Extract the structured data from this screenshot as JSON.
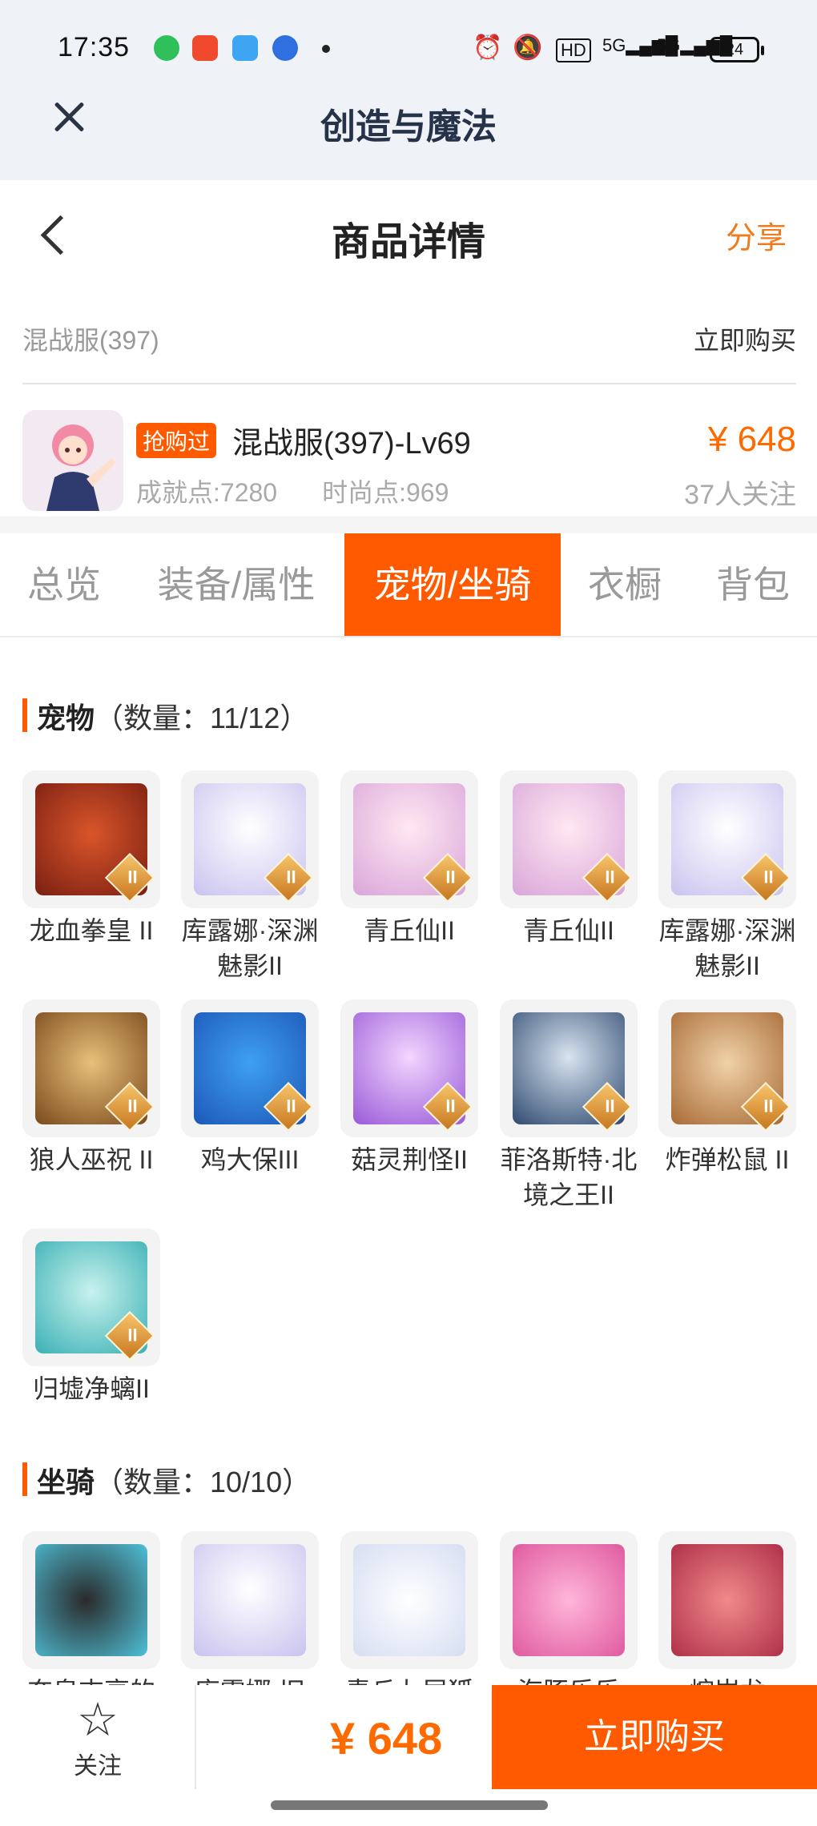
{
  "status": {
    "time": "17:35",
    "network": "5G",
    "battery": "24"
  },
  "app": {
    "title": "创造与魔法"
  },
  "header": {
    "title": "商品详情",
    "share": "分享"
  },
  "server": {
    "name": "混战服(397)",
    "buy_now": "立即购买"
  },
  "product": {
    "badge": "抢购过",
    "name": "混战服(397)-Lv69",
    "achievement": "成就点:7280",
    "fashion": "时尚点:969",
    "price": "¥ 648",
    "followers": "37人关注"
  },
  "tabs": [
    {
      "label": "总览"
    },
    {
      "label": "装备/属性"
    },
    {
      "label": "宠物/坐骑"
    },
    {
      "label": "衣橱"
    },
    {
      "label": "背包"
    }
  ],
  "pets": {
    "title": "宠物",
    "count": "（数量：11/12）",
    "items": [
      {
        "name": "龙血拳皇 II"
      },
      {
        "name": "库露娜·深渊魅影II"
      },
      {
        "name": "青丘仙II"
      },
      {
        "name": "青丘仙II"
      },
      {
        "name": "库露娜·深渊魅影II"
      },
      {
        "name": "狼人巫祝 II"
      },
      {
        "name": "鸡大保III"
      },
      {
        "name": "菇灵荆怪II"
      },
      {
        "name": "菲洛斯特·北境之王II"
      },
      {
        "name": "炸弹松鼠 II"
      },
      {
        "name": "归墟净螭II"
      }
    ]
  },
  "mounts": {
    "title": "坐骑",
    "count": "（数量：10/10）",
    "items": [
      {
        "name": "奔泉吉享的"
      },
      {
        "name": "库露娜·旧"
      },
      {
        "name": "青丘九尾狐"
      },
      {
        "name": "海豚乐乐"
      },
      {
        "name": "熔岩龙"
      }
    ]
  },
  "bottom": {
    "follow": "关注",
    "price": "¥ 648",
    "buy": "立即购买"
  }
}
